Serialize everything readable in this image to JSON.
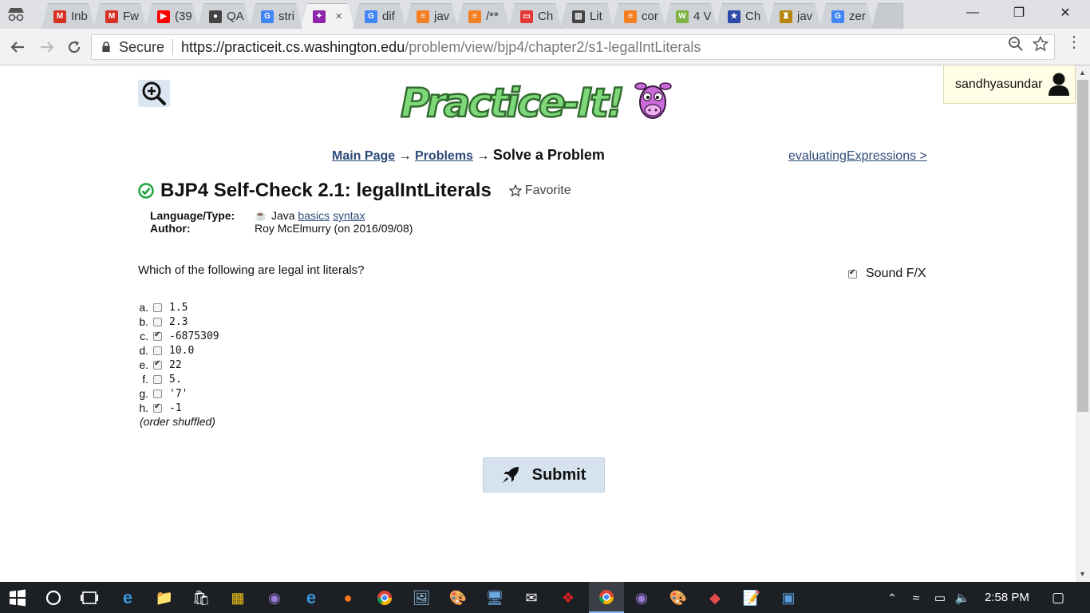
{
  "browser": {
    "tabs": [
      {
        "title": "Inb",
        "icon": "gmail-icon",
        "color": "#d93025",
        "glyph": "M"
      },
      {
        "title": "Fw",
        "icon": "gmail-icon",
        "color": "#d93025",
        "glyph": "M"
      },
      {
        "title": "(39",
        "icon": "youtube-icon",
        "color": "#ff0000",
        "glyph": "▶"
      },
      {
        "title": "QA",
        "icon": "github-icon",
        "color": "#444444",
        "glyph": "●"
      },
      {
        "title": "stri",
        "icon": "google-icon",
        "color": "#4285f4",
        "glyph": "G"
      },
      {
        "title": "",
        "icon": "practiceit-icon",
        "color": "#8e24aa",
        "glyph": "✦",
        "active": true
      },
      {
        "title": "dif",
        "icon": "google-icon",
        "color": "#4285f4",
        "glyph": "G"
      },
      {
        "title": "jav",
        "icon": "stackoverflow-icon",
        "color": "#f48024",
        "glyph": "≡"
      },
      {
        "title": "/**",
        "icon": "stackoverflow-icon",
        "color": "#f48024",
        "glyph": "≡"
      },
      {
        "title": "Ch",
        "icon": "oracle-icon",
        "color": "#e53935",
        "glyph": "▭"
      },
      {
        "title": "Lit",
        "icon": "library-icon",
        "color": "#444444",
        "glyph": "▥"
      },
      {
        "title": "cor",
        "icon": "stackoverflow-icon",
        "color": "#f48024",
        "glyph": "≡"
      },
      {
        "title": "4 V",
        "icon": "wikihow-icon",
        "color": "#7cb342",
        "glyph": "W"
      },
      {
        "title": "Ch",
        "icon": "star-icon",
        "color": "#2e4aa8",
        "glyph": "★"
      },
      {
        "title": "jav",
        "icon": "crest-icon",
        "color": "#b8860b",
        "glyph": "♜"
      },
      {
        "title": "zer",
        "icon": "google-icon",
        "color": "#4285f4",
        "glyph": "G"
      }
    ],
    "close_tab_glyph": "×",
    "url": {
      "secure_label": "Secure",
      "host": "https://practiceit.cs.washington.edu",
      "path": "/problem/view/bjp4/chapter2/s1-legalIntLiterals"
    }
  },
  "page": {
    "user": "sandhyasundar",
    "breadcrumb": {
      "main": "Main Page",
      "arrow1": " → ",
      "problems": "Problems",
      "arrow2": " → ",
      "current": "Solve a Problem"
    },
    "next_link": "evaluatingExpressions >",
    "title": "BJP4 Self-Check 2.1: legalIntLiterals",
    "favorite_label": "Favorite",
    "meta": {
      "lang_label": "Language/Type:",
      "lang_value": "Java",
      "tag1": "basics",
      "tag2": "syntax",
      "author_label": "Author:",
      "author_value": "Roy McElmurry (on 2016/09/08)"
    },
    "question": "Which of the following are legal int literals?",
    "sound_label": "Sound F/X",
    "sound_checked": true,
    "choices": [
      {
        "letter": "a.",
        "value": "1.5",
        "checked": false
      },
      {
        "letter": "b.",
        "value": "2.3",
        "checked": false
      },
      {
        "letter": "c.",
        "value": "-6875309",
        "checked": true
      },
      {
        "letter": "d.",
        "value": "10.0",
        "checked": false
      },
      {
        "letter": "e.",
        "value": "22",
        "checked": true
      },
      {
        "letter": "f.",
        "value": "5.",
        "checked": false
      },
      {
        "letter": "g.",
        "value": "'7'",
        "checked": false
      },
      {
        "letter": "h.",
        "value": "-1",
        "checked": true
      }
    ],
    "shuffled_note": "(order shuffled)",
    "submit_label": "Submit"
  },
  "taskbar": {
    "time": "2:58 PM"
  }
}
